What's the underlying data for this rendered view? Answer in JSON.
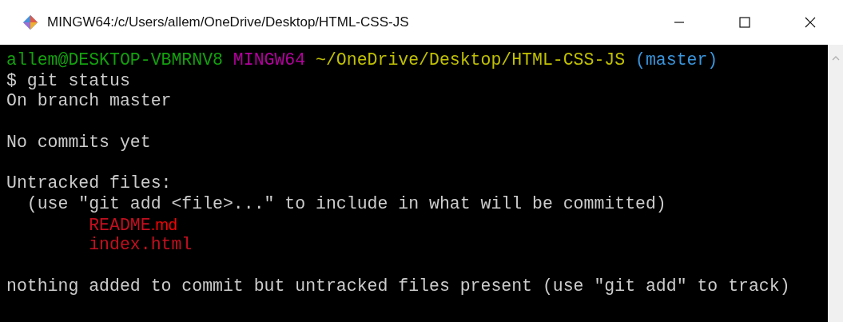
{
  "window": {
    "title": "MINGW64:/c/Users/allem/OneDrive/Desktop/HTML-CSS-JS"
  },
  "terminal": {
    "lines": [
      {
        "kind": "prompt",
        "segments": [
          {
            "text": "allem@DESKTOP-VBMRNV8",
            "color": "#13a10e",
            "kind": "mono"
          },
          {
            "text": "MINGW64",
            "color": "#b4009e",
            "kind": "mono"
          },
          {
            "text": "~/OneDrive/Desktop/HTML-CSS-JS",
            "color": "#c1c100",
            "kind": "mono"
          },
          {
            "text": "(master)",
            "color": "#3a96dd",
            "kind": "mono"
          }
        ]
      },
      {
        "kind": "text",
        "segments": [
          {
            "text": "$ git status",
            "color": "#cccccc",
            "kind": "mono"
          }
        ]
      },
      {
        "kind": "text",
        "segments": [
          {
            "text": "On branch master",
            "color": "#cccccc",
            "kind": "mono"
          }
        ]
      },
      {
        "kind": "blank"
      },
      {
        "kind": "text",
        "segments": [
          {
            "text": "No commits yet",
            "color": "#cccccc",
            "kind": "mono"
          }
        ]
      },
      {
        "kind": "blank"
      },
      {
        "kind": "text",
        "segments": [
          {
            "text": "Untracked files:",
            "color": "#cccccc",
            "kind": "mono"
          }
        ]
      },
      {
        "kind": "text",
        "segments": [
          {
            "text": "  (use \"git add <file>...\" to include in what will be committed)",
            "color": "#cccccc",
            "kind": "mono"
          }
        ]
      },
      {
        "kind": "text",
        "segments": [
          {
            "text": "        README",
            "color": "#c50f1f",
            "kind": "mono"
          },
          {
            "text": ".md",
            "color": "#ff0000",
            "kind": "sans"
          }
        ]
      },
      {
        "kind": "text",
        "segments": [
          {
            "text": "        index.html",
            "color": "#c50f1f",
            "kind": "mono"
          }
        ]
      },
      {
        "kind": "blank"
      },
      {
        "kind": "text",
        "segments": [
          {
            "text": "nothing added to commit but untracked files present (use \"git add\" to track)",
            "color": "#cccccc",
            "kind": "mono"
          }
        ]
      }
    ]
  }
}
